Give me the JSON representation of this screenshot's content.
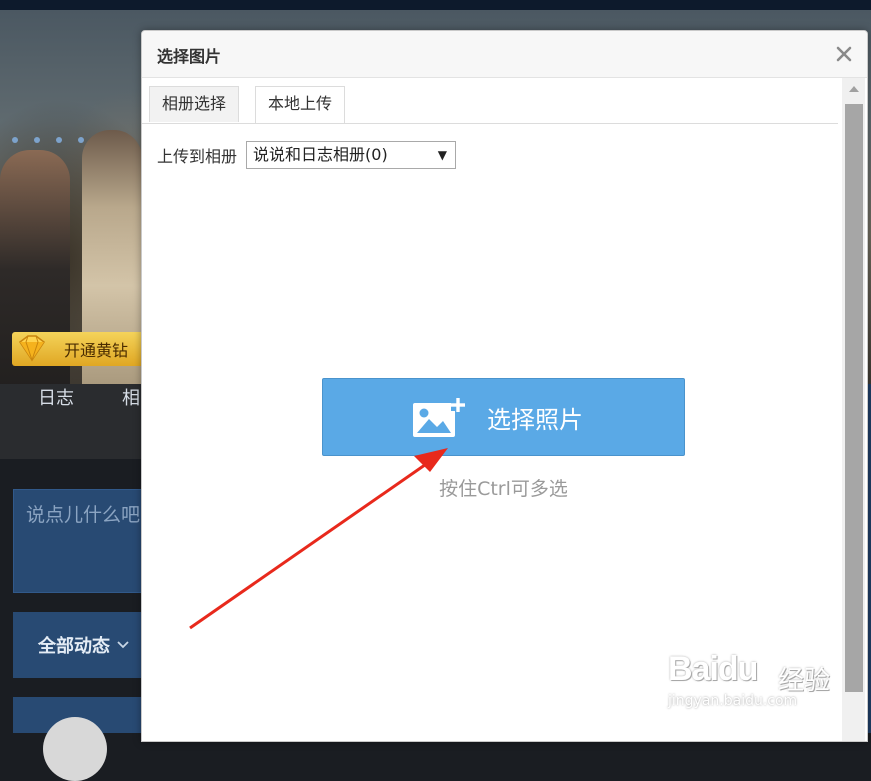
{
  "background": {
    "vip_badge_label": "开通黄钻",
    "nav_items": [
      "日志",
      "相"
    ],
    "post_placeholder": "说点儿什么吧",
    "filter_label": "全部动态"
  },
  "dialog": {
    "title": "选择图片",
    "tabs": [
      {
        "label": "相册选择",
        "active": false
      },
      {
        "label": "本地上传",
        "active": true
      }
    ],
    "upload_to_label": "上传到相册",
    "album_select_value": "说说和日志相册(0)",
    "pick_button_label": "选择照片",
    "hint": "按住Ctrl可多选"
  },
  "watermark": {
    "brand": "Baidu",
    "cn": "经验",
    "url": "jingyan.baidu.com"
  },
  "icons": {
    "close": "close-icon",
    "image_add": "image-add-icon",
    "diamond": "diamond-icon",
    "chevron": "chevron-down-icon",
    "dropdown": "dropdown-arrow-icon"
  },
  "colors": {
    "primary_button": "#5aa9e6",
    "vip_gold": "#f4d35a",
    "panel_blue": "#284a73",
    "annotation_red": "#e8291c"
  }
}
